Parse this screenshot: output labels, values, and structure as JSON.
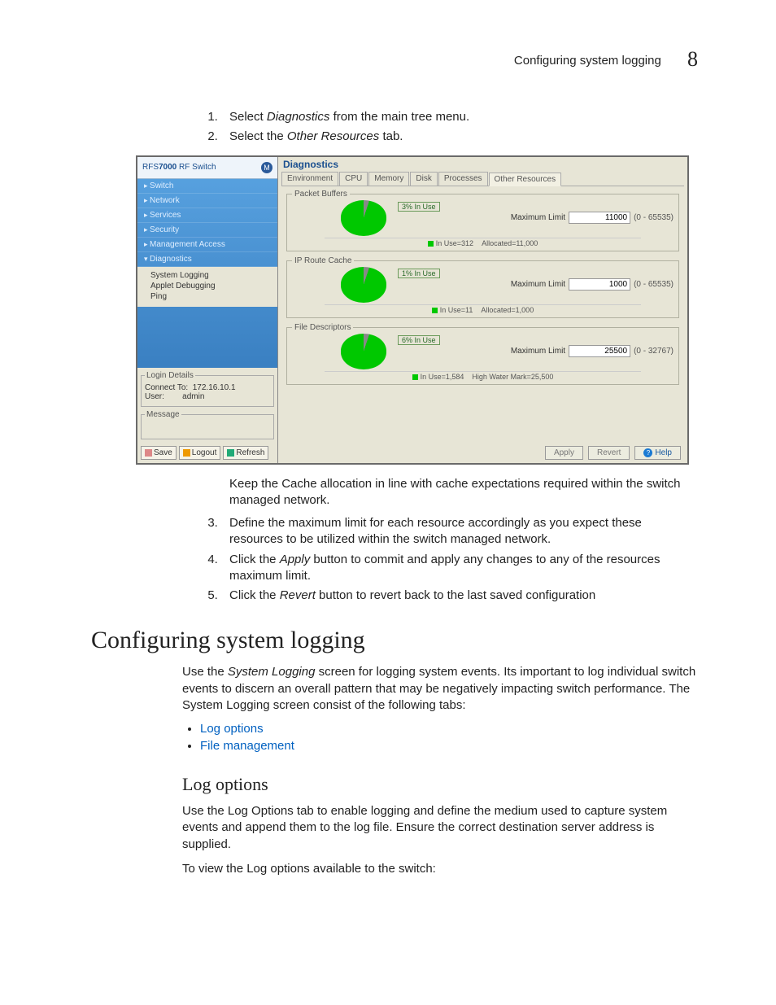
{
  "header": {
    "title": "Configuring system logging",
    "chapter": "8"
  },
  "steps_top": [
    {
      "pre": "Select ",
      "em": "Diagnostics",
      "post": " from the main tree menu."
    },
    {
      "pre": "Select the ",
      "em": "Other Resources",
      "post": " tab."
    }
  ],
  "shot": {
    "brand_prefix": "RFS",
    "brand_bold": "7000",
    "brand_suffix": " RF Switch",
    "nav": [
      "Switch",
      "Network",
      "Services",
      "Security",
      "Management Access",
      "Diagnostics"
    ],
    "subtree": [
      "System Logging",
      "Applet Debugging",
      "Ping"
    ],
    "login": {
      "legend": "Login Details",
      "connect_label": "Connect To:",
      "connect_val": "172.16.10.1",
      "user_label": "User:",
      "user_val": "admin",
      "message_legend": "Message"
    },
    "foot": {
      "save": "Save",
      "logout": "Logout",
      "refresh": "Refresh"
    },
    "title": "Diagnostics",
    "tabs": [
      "Environment",
      "CPU",
      "Memory",
      "Disk",
      "Processes",
      "Other Resources"
    ],
    "panels": [
      {
        "legend": "Packet Buffers",
        "pct": "3% In Use",
        "caption_left": "In Use=312",
        "caption_right": "Allocated=11,000",
        "max_label": "Maximum Limit",
        "max_value": "11000",
        "range": "(0 - 65535)"
      },
      {
        "legend": "IP Route Cache",
        "pct": "1% In Use",
        "caption_left": "In Use=11",
        "caption_right": "Allocated=1,000",
        "max_label": "Maximum Limit",
        "max_value": "1000",
        "range": "(0 - 65535)"
      },
      {
        "legend": "File Descriptors",
        "pct": "6% In Use",
        "caption_left": "In Use=1,584",
        "caption_right": "High Water Mark=25,500",
        "max_label": "Maximum Limit",
        "max_value": "25500",
        "range": "(0 - 32767)"
      }
    ],
    "buttons": {
      "apply": "Apply",
      "revert": "Revert",
      "help": "Help"
    }
  },
  "after_image": "Keep the Cache allocation in line with cache expectations required within the switch managed network.",
  "steps_bottom": [
    {
      "text": "Define the maximum limit for each resource accordingly as you expect these resources to be utilized within the switch managed network."
    },
    {
      "pre": "Click the ",
      "em": "Apply",
      "post": " button to commit and apply any changes to any of the resources maximum limit."
    },
    {
      "pre": "Click the ",
      "em": "Revert",
      "post": " button to revert back to the last saved configuration"
    }
  ],
  "h1": "Configuring system logging",
  "p1_pre": "Use the ",
  "p1_em": "System Logging",
  "p1_post": " screen for logging system events. Its important to log individual switch events to discern an overall pattern that may be negatively impacting switch performance. The System Logging screen consist of the following tabs:",
  "links": [
    "Log options",
    "File management"
  ],
  "h2": "Log options",
  "p2": "Use the Log Options tab to enable logging and define the medium used to capture system events and append them to the log file. Ensure the correct destination server address is supplied.",
  "p3": "To view the Log options available to the switch:"
}
